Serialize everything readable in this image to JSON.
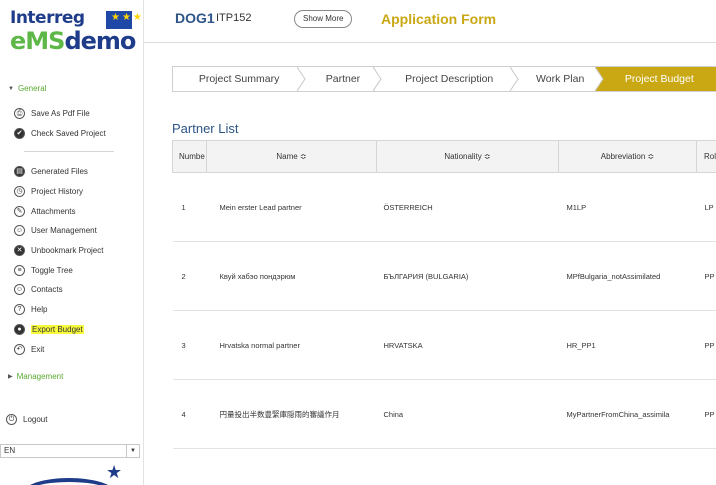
{
  "logo": {
    "top": "Interreg",
    "bottom_prefix": "eMS",
    "bottom_suffix": "demo",
    "flag_stars": "★★★"
  },
  "sidebar": {
    "general_label": "General",
    "menu_top": [
      {
        "label": "Save As Pdf File",
        "icon": "print-icon"
      },
      {
        "label": "Check Saved Project",
        "icon": "check-icon"
      }
    ],
    "menu_main": [
      {
        "label": "Generated Files",
        "icon": "files-icon"
      },
      {
        "label": "Project History",
        "icon": "history-icon"
      },
      {
        "label": "Attachments",
        "icon": "paperclip-icon"
      },
      {
        "label": "User Management",
        "icon": "user-icon"
      },
      {
        "label": "Unbookmark Project",
        "icon": "x-icon"
      },
      {
        "label": "Toggle Tree",
        "icon": "tree-icon"
      },
      {
        "label": "Contacts",
        "icon": "contacts-icon"
      },
      {
        "label": "Help",
        "icon": "help-icon"
      },
      {
        "label": "Export Budget",
        "icon": "export-icon"
      },
      {
        "label": "Exit",
        "icon": "exit-icon"
      }
    ],
    "management_label": "Management",
    "logout_label": "Logout",
    "language": "EN"
  },
  "header": {
    "project_code": "DOG1",
    "acronym": "ITP152",
    "show_more": "Show More",
    "title": "Application Form"
  },
  "tabs": [
    {
      "label": "Project Summary",
      "active": false
    },
    {
      "label": "Partner",
      "active": false
    },
    {
      "label": "Project Description",
      "active": false
    },
    {
      "label": "Work Plan",
      "active": false
    },
    {
      "label": "Project Budget",
      "active": true
    }
  ],
  "partner_list": {
    "title": "Partner List",
    "columns": [
      "Numbe ≎",
      "Name ≎",
      "Nationality ≎",
      "Abbreviation ≎",
      "Rol ≎"
    ],
    "rows": [
      {
        "number": "1",
        "name": "Mein erster Lead partner",
        "nationality": "ÖSTERREICH",
        "abbreviation": "M1LP",
        "role": "LP"
      },
      {
        "number": "2",
        "name": "Квуй хабэо пондэрюм",
        "nationality": "БЪЛГАРИЯ (BULGARIA)",
        "abbreviation": "MPfBulgaria_notAssimilated",
        "role": "PP"
      },
      {
        "number": "3",
        "name": "Hrvatska normal partner",
        "nationality": "HRVATSKA",
        "abbreviation": "HR_PP1",
        "role": "PP"
      },
      {
        "number": "4",
        "name": "円量投出半数豊緊庫隠雨的審議作月",
        "nationality": "China",
        "abbreviation": "MyPartnerFromChina_assimila",
        "role": "PP"
      }
    ]
  },
  "colors": {
    "accent_gold": "#c9a813",
    "title_blue": "#2d5587",
    "section_green": "#5aa832",
    "highlight_yellow": "#f8fa3c"
  }
}
